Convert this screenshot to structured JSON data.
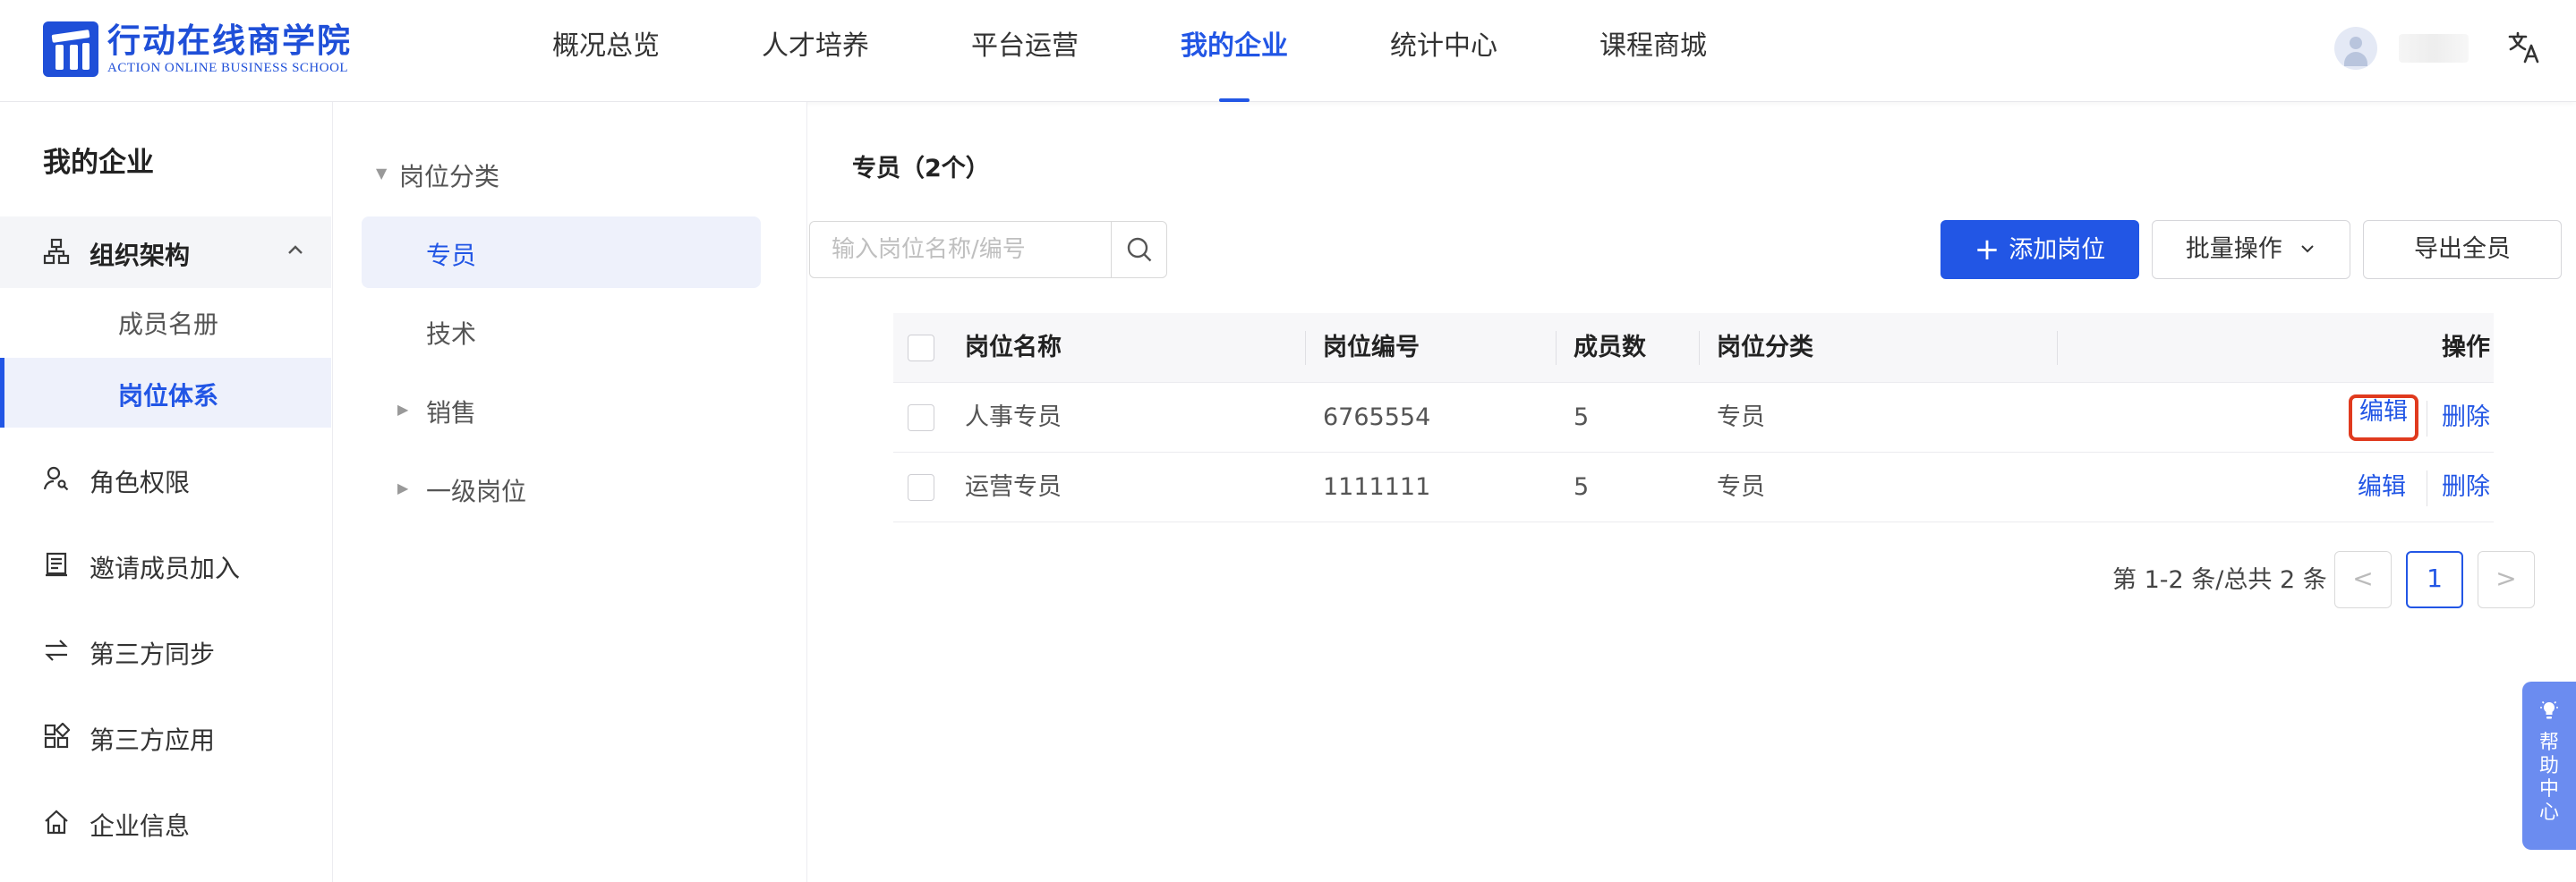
{
  "header": {
    "logo_cn": "行动在线商学院",
    "logo_en": "ACTION ONLINE BUSINESS SCHOOL",
    "nav": [
      "概况总览",
      "人才培养",
      "平台运营",
      "我的企业",
      "统计中心",
      "课程商城"
    ],
    "active_nav": "我的企业",
    "lang_icon": "translate-icon"
  },
  "sidebar": {
    "title": "我的企业",
    "group": {
      "label": "组织架构",
      "icon": "org-tree-icon",
      "expanded": true
    },
    "sub_items": [
      "成员名册",
      "岗位体系"
    ],
    "active_sub": "岗位体系",
    "items": [
      {
        "label": "角色权限",
        "icon": "user-key-icon"
      },
      {
        "label": "邀请成员加入",
        "icon": "invite-doc-icon"
      },
      {
        "label": "第三方同步",
        "icon": "sync-arrows-icon"
      },
      {
        "label": "第三方应用",
        "icon": "apps-grid-icon"
      },
      {
        "label": "企业信息",
        "icon": "home-icon"
      }
    ]
  },
  "category_tree": {
    "root": "岗位分类",
    "children": [
      "专员",
      "技术",
      "销售",
      "一级岗位"
    ],
    "active": "专员"
  },
  "main": {
    "title": "专员（2个）",
    "search_placeholder": "输入岗位名称/编号",
    "add_button": "添加岗位",
    "batch_button": "批量操作",
    "export_button": "导出全员"
  },
  "table": {
    "columns": [
      "岗位名称",
      "岗位编号",
      "成员数",
      "岗位分类",
      "操作"
    ],
    "rows": [
      {
        "name": "人事专员",
        "code": "6765554",
        "members": "5",
        "category": "专员",
        "edit": "编辑",
        "delete": "删除"
      },
      {
        "name": "运营专员",
        "code": "1111111",
        "members": "5",
        "category": "专员",
        "edit": "编辑",
        "delete": "删除"
      }
    ]
  },
  "pagination": {
    "summary": "第 1-2 条/总共 2 条",
    "prev": "<",
    "current": "1",
    "next": ">"
  },
  "help_tab": {
    "label": "帮助中心"
  },
  "colors": {
    "accent": "#2256e5",
    "highlight": "#e03a1e",
    "help_tab": "#6b8cf0"
  }
}
